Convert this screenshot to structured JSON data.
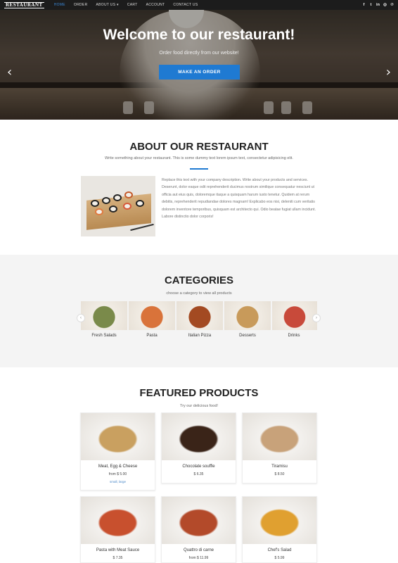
{
  "nav": {
    "logo": "RESTAURANT",
    "items": [
      {
        "label": "HOME",
        "active": true
      },
      {
        "label": "ORDER",
        "active": false
      },
      {
        "label": "ABOUT US ▾",
        "active": false
      },
      {
        "label": "CART",
        "active": false
      },
      {
        "label": "ACCOUNT",
        "active": false
      },
      {
        "label": "CONTACT US",
        "active": false
      }
    ],
    "socials": [
      {
        "icon": "facebook-icon",
        "glyph": "f"
      },
      {
        "icon": "twitter-icon",
        "glyph": "t"
      },
      {
        "icon": "linkedin-icon",
        "glyph": "in"
      },
      {
        "icon": "instagram-icon",
        "glyph": "◎"
      },
      {
        "icon": "pinterest-icon",
        "glyph": "℗"
      }
    ]
  },
  "hero": {
    "title": "Welcome to our restaurant!",
    "subtitle": "Order food directly from our website!",
    "button": "MAKE AN ORDER",
    "prev_glyph": "‹",
    "next_glyph": "›"
  },
  "about": {
    "title": "ABOUT OUR RESTAURANT",
    "subtitle": "Write something about your restaurant. This is some dummy text lorem ipsum text, consectetur adipisicing elit.",
    "body": "Replace this text with your company description. Write about your products and services. Deserunt, dolor eaque odit reprehenderit ducimus nostrum similique consequatur nesciunt ut officia aut eius quis, doloremque itaque a quisquam harum iusto tenetur. Quidem at rerum debitis, reprehenderit repudiandae dolores magnam! Explicabo eos nisi, deleniti cum veritatis dolorem inventore temporibus, quisquam est architecto qui. Odio beatae fugiat ullam incidunt. Labore distinctio dolor corporis!"
  },
  "categories": {
    "title": "CATEGORIES",
    "subtitle": "choose a category to view all products",
    "prev_glyph": "‹",
    "next_glyph": "›",
    "items": [
      {
        "label": "Fresh Salads",
        "color": "#7a8a4a"
      },
      {
        "label": "Pasta",
        "color": "#d9733a"
      },
      {
        "label": "Italian Pizza",
        "color": "#a34a22"
      },
      {
        "label": "Desserts",
        "color": "#c89a5a"
      },
      {
        "label": "Drinks",
        "color": "#c84a3a"
      }
    ]
  },
  "featured": {
    "title": "FEATURED PRODUCTS",
    "subtitle": "Try our delicious food!",
    "products": [
      {
        "name": "Meat, Egg & Cheese",
        "price": "from $ 5.00",
        "options": "small, large",
        "color": "#c9a060"
      },
      {
        "name": "Chocolate souffle",
        "price": "$ 6.35",
        "options": "",
        "color": "#3a2418"
      },
      {
        "name": "Tiramisu",
        "price": "$ 8.50",
        "options": "",
        "color": "#c8a27a"
      },
      {
        "name": "Pasta with Meat Sauce",
        "price": "$ 7.35",
        "options": "",
        "color": "#c8502e"
      },
      {
        "name": "Quattro di carne",
        "price": "from $ 11.99",
        "options": "",
        "color": "#b34a2a"
      },
      {
        "name": "Chef's Salad",
        "price": "$ 5.99",
        "options": "",
        "color": "#e0a030"
      }
    ]
  },
  "colors": {
    "accent": "#1f7ad2",
    "nav_bg": "#1c1c1c",
    "section_bg": "#f4f4f4"
  }
}
